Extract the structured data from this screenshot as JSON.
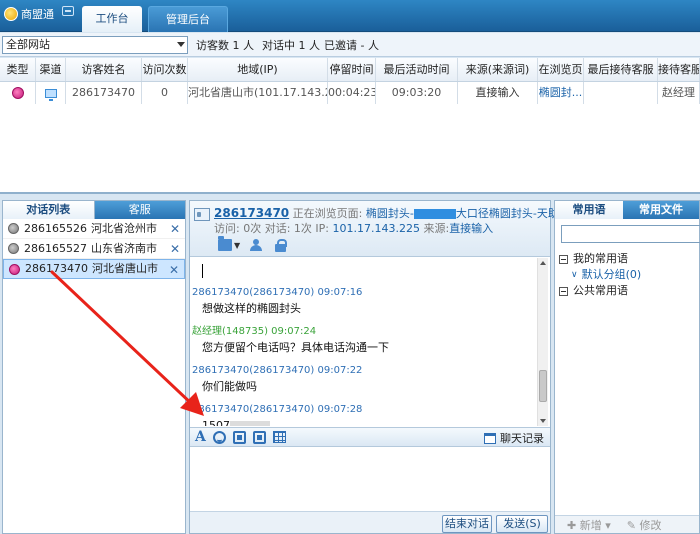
{
  "app": {
    "title": "商盟通"
  },
  "tabs": [
    {
      "label": "工作台"
    },
    {
      "label": "管理后台"
    }
  ],
  "filter": {
    "site_select": "全部网站",
    "visitors": "访客数 1 人",
    "chatting": "对话中 1 人",
    "invited": "已邀请 - 人"
  },
  "visitor_table": {
    "columns": [
      "类型",
      "渠道",
      "访客姓名",
      "访问次数",
      "地域(IP)",
      "停留时间",
      "最后活动时间",
      "来源(来源词)",
      "在浏览页",
      "最后接待客服",
      "接待客服"
    ],
    "rows": [
      {
        "name": "286173470",
        "visits": "0",
        "region": "河北省唐山市(101.17.143.225)",
        "stay": "00:04:23",
        "last_active": "09:03:20",
        "source": "直接输入",
        "page": "椭圆封...",
        "last_agent": "",
        "agent": "赵经理"
      }
    ]
  },
  "conversation_list": {
    "tabs": [
      "对话列表",
      "客服"
    ],
    "items": [
      {
        "id": "286165526",
        "region": "河北省沧州市"
      },
      {
        "id": "286165527",
        "region": "山东省济南市"
      },
      {
        "id": "286173470",
        "region": "河北省唐山市"
      }
    ]
  },
  "chat": {
    "header": {
      "visitor_id": "286173470",
      "browsing_label": "正在浏览页面:",
      "page_title_start": "椭圆封头-",
      "page_title_end": "大口径椭圆封头-天助网",
      "visits_line": "访问: 0次 对话: 1次 IP:",
      "ip": "101.17.143.225",
      "source_label": "来源:",
      "source": "直接输入"
    },
    "messages": [
      {
        "meta": "286173470(286173470)  09:07:16",
        "text": "想做这样的椭圆封头",
        "role": "visitor"
      },
      {
        "meta": "赵经理(148735)  09:07:24",
        "text": "您方便留个电话吗？具体电话沟通一下",
        "role": "agent"
      },
      {
        "meta": "286173470(286173470)  09:07:22",
        "text": "你们能做吗",
        "role": "visitor"
      },
      {
        "meta": "286173470(286173470)  09:07:28",
        "text": "1507",
        "role": "visitor"
      }
    ],
    "history_label": "聊天记录",
    "end_button": "结束对话",
    "send_button": "发送(S)"
  },
  "right_panel": {
    "tabs": [
      "常用语",
      "常用文件"
    ],
    "tree": {
      "mine": "我的常用语",
      "default_group": "默认分组(0)",
      "public": "公共常用语"
    },
    "add_label": "新增",
    "edit_label": "修改"
  },
  "colors": {
    "accent": "#1a62a8",
    "agent_green": "#3aa33a",
    "annotation_red": "#e8231a"
  }
}
